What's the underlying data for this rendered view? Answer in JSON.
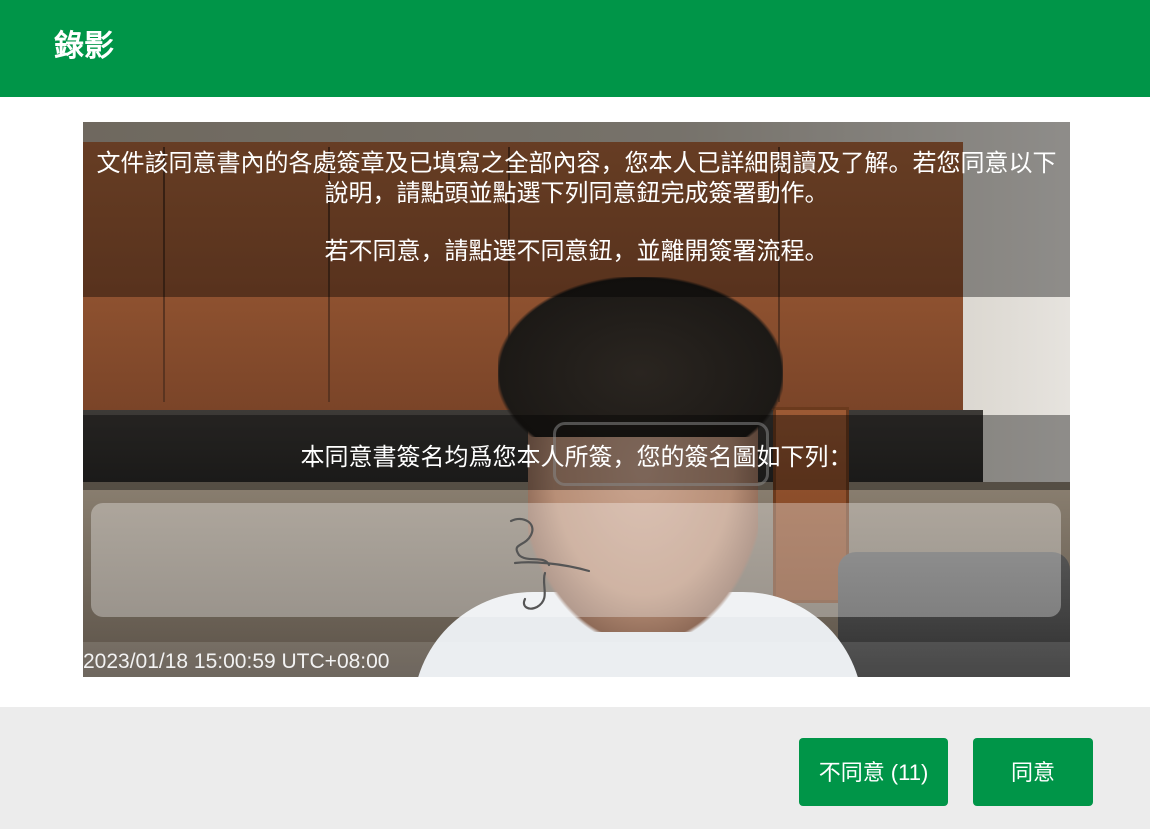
{
  "header": {
    "title": "錄影"
  },
  "video": {
    "consent_line1": "文件該同意書內的各處簽章及已填寫之全部內容，您本人已詳細閱讀及了解。若您同意以下說明，請點頭並點選下列同意鈕完成簽署動作。",
    "consent_line2": "若不同意，請點選不同意鈕，並離開簽署流程。",
    "signature_caption": "本同意書簽名均爲您本人所簽，您的簽名圖如下列：",
    "timestamp": "2023/01/18 15:00:59 UTC+08:00"
  },
  "footer": {
    "disagree_label": "不同意 (11)",
    "agree_label": "同意"
  },
  "colors": {
    "brand": "#009548",
    "footer_bg": "#ececec"
  }
}
